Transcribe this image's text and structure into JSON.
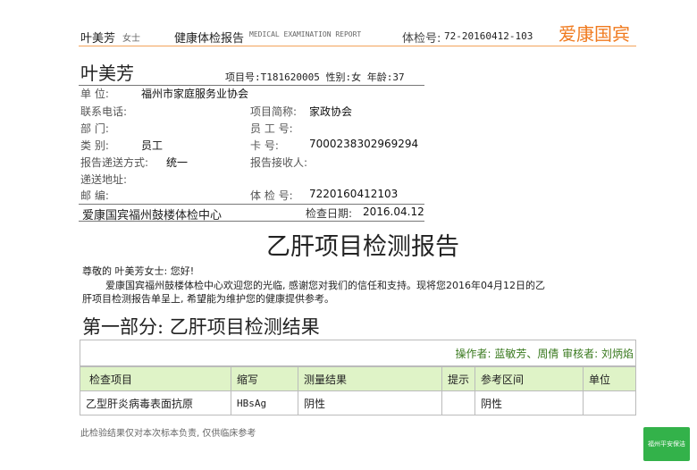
{
  "header": {
    "name": "叶美芳",
    "gender": "女士",
    "report_title": "健康体检报告",
    "report_title_en": "MEDICAL EXAMINATION REPORT",
    "exam_no_label": "体检号:",
    "exam_no": "72-20160412-103",
    "brand": "爱康国宾",
    "brand_color": "#f07a1e"
  },
  "patient": {
    "name": "叶美芳",
    "summary": "项目号:T181620005 性别:女 年龄:37",
    "fields": {
      "unit_label": "单 位:",
      "unit_value": "福州市家庭服务业协会",
      "phone_label": "联系电话:",
      "dept_label": "部 门:",
      "project_abbr_label": "项目简称:",
      "project_abbr_value": "家政协会",
      "staff_no_label": "员 工 号:",
      "category_label": "类 别:",
      "category_value": "员工",
      "card_label": "卡 号:",
      "card_value": "7000238302969294",
      "delivery_label": "报告递送方式:",
      "delivery_value": "统一",
      "receiver_label": "报告接收人:",
      "address_label": "递送地址:",
      "zip_label": "邮 编:",
      "exam_no_label": "体 检 号:",
      "exam_no_value": "7220160412103"
    },
    "center": "爱康国宾福州鼓楼体检中心",
    "check_date_label": "检查日期:",
    "check_date": "2016.04.12"
  },
  "document": {
    "title": "乙肝项目检测报告",
    "greeting": "尊敬的 叶美芳女士: 您好!",
    "intro_line1": "爱康国宾福州鼓楼体检中心欢迎您的光临, 感谢您对我们的信任和支持。现将您2016年04月12日的乙",
    "intro_line2": "肝项目检测报告单呈上, 希望能为维护您的健康提供参考。",
    "section_title": "第一部分: 乙肝项目检测结果",
    "operator_line": "操作者: 蓝敏芳、周倩 审核者: 刘炳焰",
    "operator_color": "#3a7a1f"
  },
  "table": {
    "columns": [
      "检查项目",
      "缩写",
      "测量结果",
      "提示",
      "参考区间",
      "单位"
    ],
    "rows": [
      [
        "乙型肝炎病毒表面抗原",
        "HBsAg",
        "阴性",
        "",
        "阴性",
        ""
      ]
    ],
    "header_bg": "#dff3c7"
  },
  "footer": {
    "note": "此检验结果仅对本次标本负责, 仅供临床参考",
    "badge": "福州平安保洁",
    "badge_color": "#33b24a"
  }
}
